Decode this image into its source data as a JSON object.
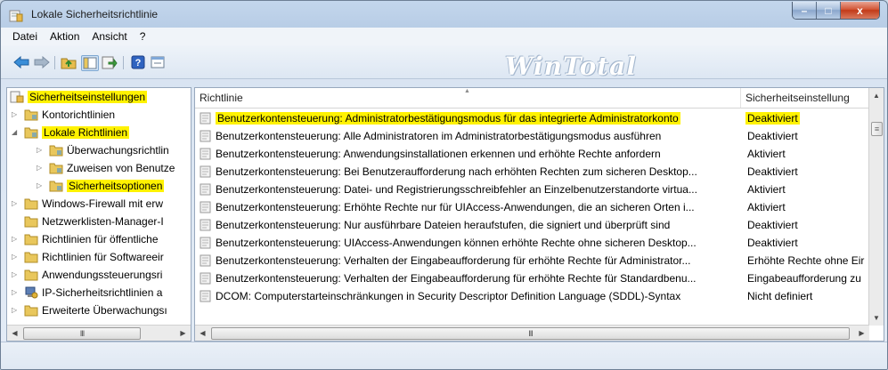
{
  "window": {
    "title": "Lokale Sicherheitsrichtlinie",
    "controls": {
      "minimize": "–",
      "maximize": "□",
      "close": "x"
    }
  },
  "menu": [
    "Datei",
    "Aktion",
    "Ansicht",
    "?"
  ],
  "watermark": "WinTotal",
  "highlight_color": "#fff200",
  "toolbar_icons": [
    "back-arrow-icon",
    "forward-arrow-icon",
    "up-folder-icon",
    "show-hide-tree-icon",
    "export-list-icon",
    "help-icon",
    "properties-icon"
  ],
  "tree": {
    "root": "Sicherheitseinstellungen",
    "items": [
      {
        "label": "Kontorichtlinien",
        "expanded": false
      },
      {
        "label": "Lokale Richtlinien",
        "expanded": true
      },
      {
        "label": "Überwachungsrichtlin",
        "expanded": false
      },
      {
        "label": "Zuweisen von Benutze",
        "expanded": false
      },
      {
        "label": "Sicherheitsoptionen",
        "expanded": false,
        "selected": true
      },
      {
        "label": "Windows-Firewall mit erw",
        "expanded": false
      },
      {
        "label": "Netzwerklisten-Manager-I",
        "expanded": false
      },
      {
        "label": "Richtlinien für öffentliche",
        "expanded": false
      },
      {
        "label": "Richtlinien für Softwareeir",
        "expanded": false
      },
      {
        "label": "Anwendungssteuerungsri",
        "expanded": false
      },
      {
        "label": "IP-Sicherheitsrichtlinien a",
        "expanded": false
      },
      {
        "label": "Erweiterte Überwachungsı",
        "expanded": false
      }
    ],
    "scroll_thumb": "III"
  },
  "list": {
    "columns": [
      "Richtlinie",
      "Sicherheitseinstellung"
    ],
    "rows": [
      {
        "policy": "Benutzerkontensteuerung: Administratorbestätigungsmodus für das integrierte Administratorkonto",
        "setting": "Deaktiviert",
        "highlighted": true
      },
      {
        "policy": "Benutzerkontensteuerung: Alle Administratoren im Administratorbestätigungsmodus ausführen",
        "setting": "Deaktiviert"
      },
      {
        "policy": "Benutzerkontensteuerung: Anwendungsinstallationen erkennen und erhöhte Rechte anfordern",
        "setting": "Aktiviert"
      },
      {
        "policy": "Benutzerkontensteuerung: Bei Benutzeraufforderung nach erhöhten Rechten zum sicheren Desktop...",
        "setting": "Deaktiviert"
      },
      {
        "policy": "Benutzerkontensteuerung: Datei- und Registrierungsschreibfehler an Einzelbenutzerstandorte virtua...",
        "setting": "Aktiviert"
      },
      {
        "policy": "Benutzerkontensteuerung: Erhöhte Rechte nur für UIAccess-Anwendungen, die an sicheren Orten i...",
        "setting": "Aktiviert"
      },
      {
        "policy": "Benutzerkontensteuerung: Nur ausführbare Dateien heraufstufen, die signiert und überprüft sind",
        "setting": "Deaktiviert"
      },
      {
        "policy": "Benutzerkontensteuerung: UIAccess-Anwendungen können erhöhte Rechte ohne sicheren Desktop...",
        "setting": "Deaktiviert"
      },
      {
        "policy": "Benutzerkontensteuerung: Verhalten der Eingabeaufforderung für erhöhte Rechte für Administrator...",
        "setting": "Erhöhte Rechte ohne Eir"
      },
      {
        "policy": "Benutzerkontensteuerung: Verhalten der Eingabeaufforderung für erhöhte Rechte für Standardbenu...",
        "setting": "Eingabeaufforderung zu"
      },
      {
        "policy": "DCOM: Computerstarteinschränkungen in Security Descriptor Definition Language (SDDL)-Syntax",
        "setting": "Nicht definiert"
      }
    ],
    "scroll_thumb": "III"
  }
}
